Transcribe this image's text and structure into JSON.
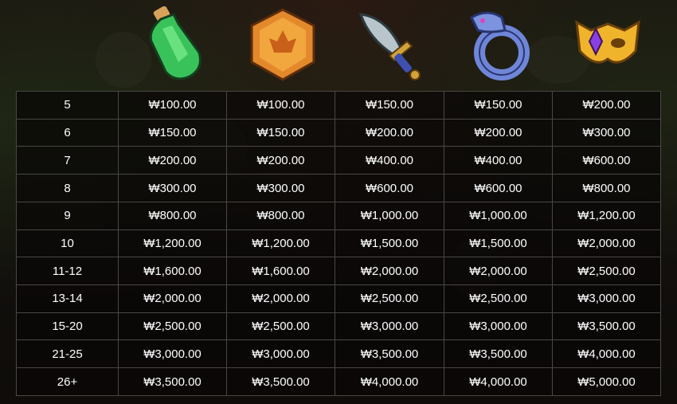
{
  "symbols": [
    {
      "icon": "green-potion-icon"
    },
    {
      "icon": "orange-hexagon-emblem-icon"
    },
    {
      "icon": "dagger-icon"
    },
    {
      "icon": "blue-dragon-ring-icon"
    },
    {
      "icon": "gold-mask-icon"
    }
  ],
  "paytable": {
    "rows": [
      {
        "count": "5",
        "values": [
          "₩100.00",
          "₩100.00",
          "₩150.00",
          "₩150.00",
          "₩200.00"
        ]
      },
      {
        "count": "6",
        "values": [
          "₩150.00",
          "₩150.00",
          "₩200.00",
          "₩200.00",
          "₩300.00"
        ]
      },
      {
        "count": "7",
        "values": [
          "₩200.00",
          "₩200.00",
          "₩400.00",
          "₩400.00",
          "₩600.00"
        ]
      },
      {
        "count": "8",
        "values": [
          "₩300.00",
          "₩300.00",
          "₩600.00",
          "₩600.00",
          "₩800.00"
        ]
      },
      {
        "count": "9",
        "values": [
          "₩800.00",
          "₩800.00",
          "₩1,000.00",
          "₩1,000.00",
          "₩1,200.00"
        ]
      },
      {
        "count": "10",
        "values": [
          "₩1,200.00",
          "₩1,200.00",
          "₩1,500.00",
          "₩1,500.00",
          "₩2,000.00"
        ]
      },
      {
        "count": "11-12",
        "values": [
          "₩1,600.00",
          "₩1,600.00",
          "₩2,000.00",
          "₩2,000.00",
          "₩2,500.00"
        ]
      },
      {
        "count": "13-14",
        "values": [
          "₩2,000.00",
          "₩2,000.00",
          "₩2,500.00",
          "₩2,500.00",
          "₩3,000.00"
        ]
      },
      {
        "count": "15-20",
        "values": [
          "₩2,500.00",
          "₩2,500.00",
          "₩3,000.00",
          "₩3,000.00",
          "₩3,500.00"
        ]
      },
      {
        "count": "21-25",
        "values": [
          "₩3,000.00",
          "₩3,000.00",
          "₩3,500.00",
          "₩3,500.00",
          "₩4,000.00"
        ]
      },
      {
        "count": "26+",
        "values": [
          "₩3,500.00",
          "₩3,500.00",
          "₩4,000.00",
          "₩4,000.00",
          "₩5,000.00"
        ]
      }
    ]
  }
}
